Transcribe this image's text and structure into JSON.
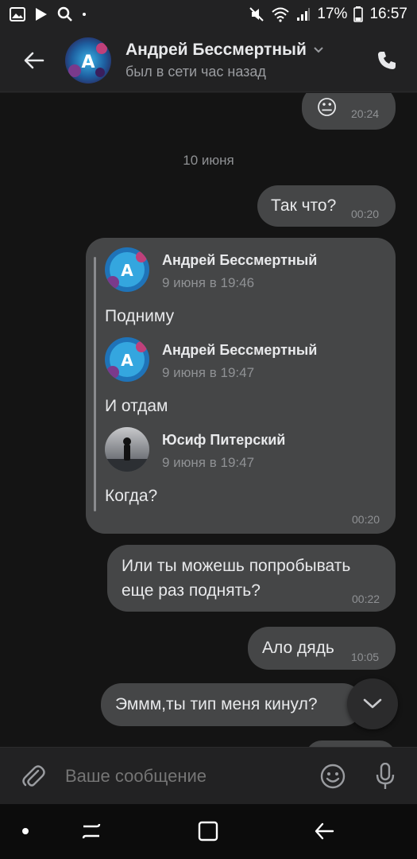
{
  "status_bar": {
    "battery": "17%",
    "time": "16:57"
  },
  "header": {
    "contact_name": "Андрей Бессмертный",
    "contact_status": "был в сети час назад"
  },
  "messages": {
    "emoji_message": {
      "emoji": "😐",
      "time": "20:24"
    },
    "date_separator": "10 июня",
    "msg1": {
      "text": "Так что?",
      "time": "00:20"
    },
    "forwarded": {
      "time": "00:20",
      "items": [
        {
          "author": "Андрей Бессмертный",
          "date": "9 июня в 19:46",
          "text": "Подниму"
        },
        {
          "author": "Андрей Бессмертный",
          "date": "9 июня в 19:47",
          "text": "И отдам"
        },
        {
          "author": "Юсиф Питерский",
          "date": "9 июня в 19:47",
          "text": "Когда?"
        }
      ]
    },
    "msg2": {
      "line1": "Или ты можешь попробывать",
      "line2": "еще раз поднять?",
      "time": "00:22"
    },
    "msg3": {
      "text": "Ало дядь",
      "time": "10:05"
    },
    "msg4": {
      "text": "Эммм,ты тип меня кинул?"
    }
  },
  "composer": {
    "placeholder": "Ваше сообщение"
  },
  "icons": {
    "back": "arrow-left-icon",
    "call": "phone-icon",
    "attach": "paperclip-icon",
    "emoji": "smile-icon",
    "mic": "microphone-icon",
    "scroll": "chevron-down-icon"
  },
  "colors": {
    "bubble": "#454647",
    "chat_background": "#141414",
    "bar_background": "#222223"
  }
}
